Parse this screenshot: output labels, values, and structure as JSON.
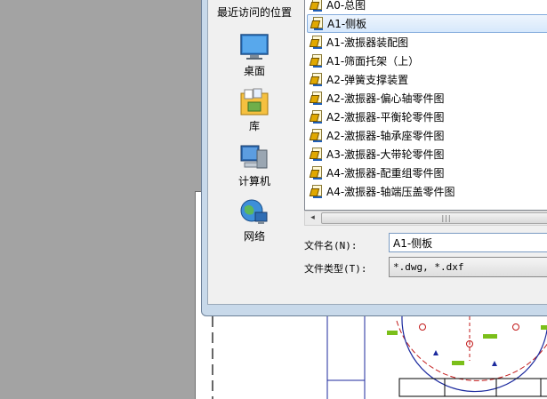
{
  "places": [
    {
      "label": "最近访问的位置",
      "icon": "recent-places-icon"
    },
    {
      "label": "桌面",
      "icon": "desktop-icon"
    },
    {
      "label": "库",
      "icon": "libraries-icon"
    },
    {
      "label": "计算机",
      "icon": "computer-icon"
    },
    {
      "label": "网络",
      "icon": "network-icon"
    }
  ],
  "files": [
    {
      "name": "A0-总图",
      "selected": false
    },
    {
      "name": "A1-侧板",
      "selected": true
    },
    {
      "name": "A1-激振器装配图",
      "selected": false
    },
    {
      "name": "A1-筛面托架（上）",
      "selected": false
    },
    {
      "name": "A2-弹簧支撑装置",
      "selected": false
    },
    {
      "name": "A2-激振器-偏心轴零件图",
      "selected": false
    },
    {
      "name": "A2-激振器-平衡轮零件图",
      "selected": false
    },
    {
      "name": "A2-激振器-轴承座零件图",
      "selected": false
    },
    {
      "name": "A3-激振器-大带轮零件图",
      "selected": false
    },
    {
      "name": "A4-激振器-配重组零件图",
      "selected": false
    },
    {
      "name": "A4-激振器-轴端压盖零件图",
      "selected": false
    }
  ],
  "filename": {
    "label": "文件名(N):",
    "value": "A1-侧板"
  },
  "filetype": {
    "label": "文件类型(T):",
    "value": "*.dwg, *.dxf"
  },
  "scrollbar": {
    "left_arrow": "◂",
    "grip": "|||"
  },
  "colors": {
    "selection": "#d6e8fc",
    "cad_blue": "#1c2a9e",
    "cad_red": "#c21a1a",
    "cad_green": "#7bbf1a"
  }
}
